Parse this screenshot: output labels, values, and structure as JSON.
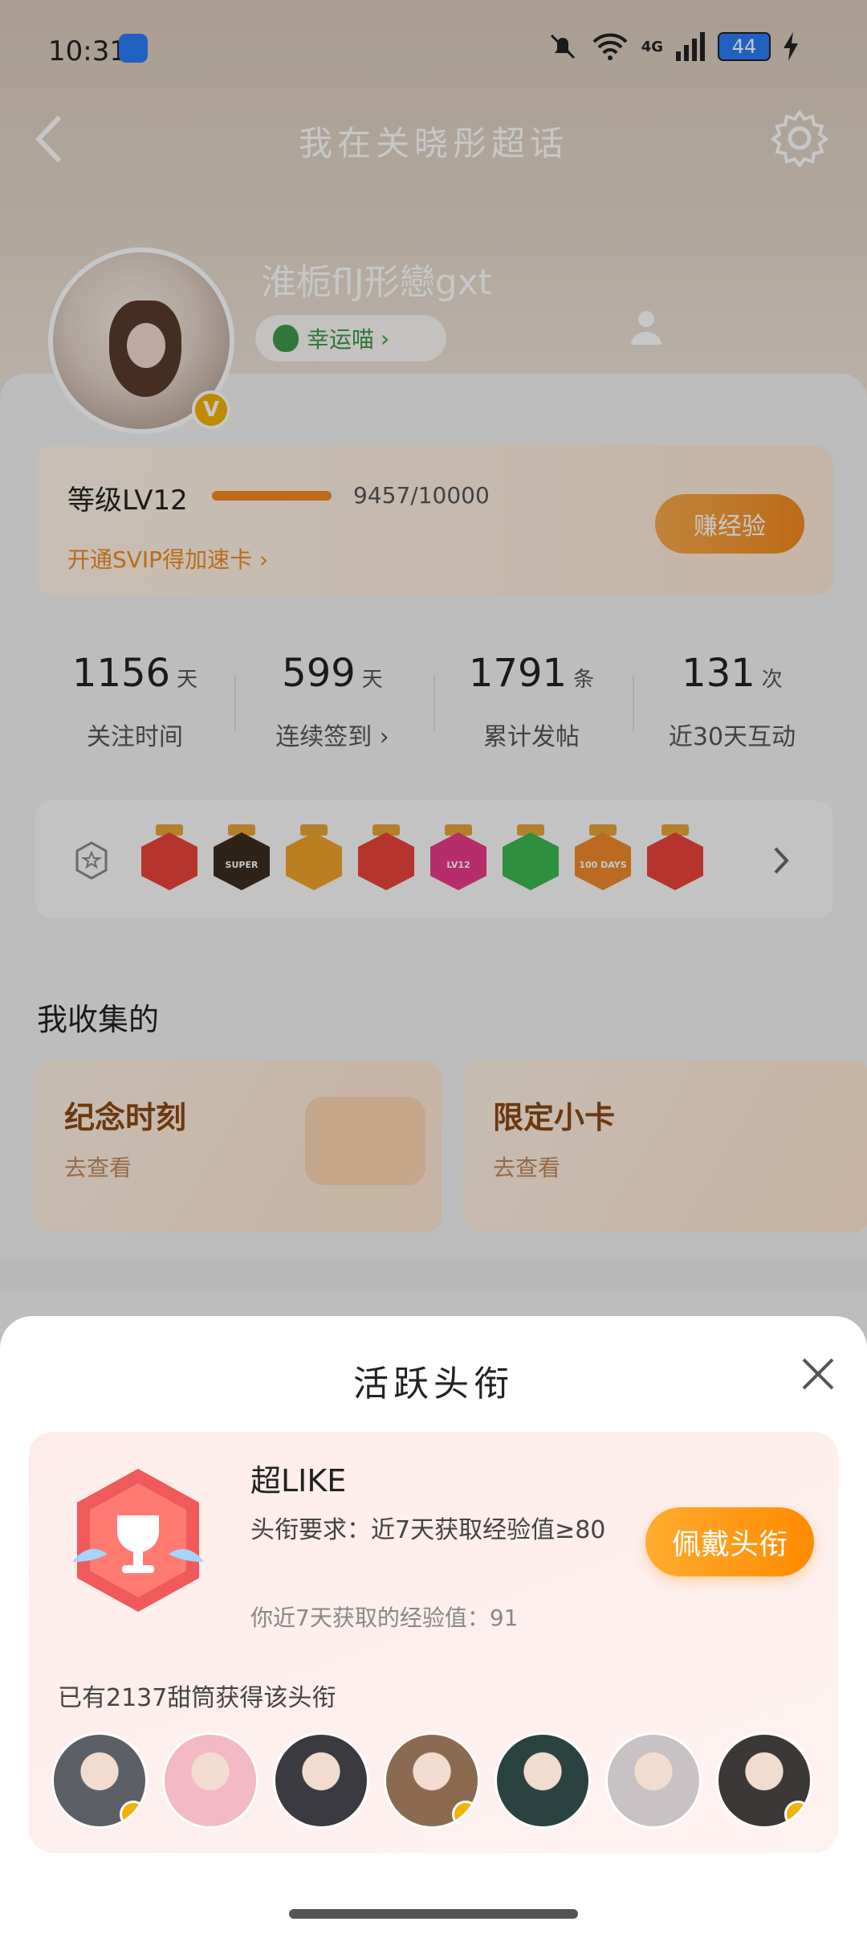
{
  "status_bar": {
    "time": "10:31",
    "network": "4G",
    "battery": "44"
  },
  "header": {
    "title": "我在关晓彤超话",
    "username": "淮栀flJ形戀gxt",
    "lucky_label": "幸运喵"
  },
  "level": {
    "label": "等级LV12",
    "progress": "9457/10000",
    "progress_fraction": 0.9457,
    "svip_link": "开通SVIP得加速卡",
    "earn_button": "赚经验"
  },
  "stats": [
    {
      "value": "1156",
      "unit": "天",
      "label": "关注时间"
    },
    {
      "value": "599",
      "unit": "天",
      "label": "连续签到"
    },
    {
      "value": "1791",
      "unit": "条",
      "label": "累计发帖"
    },
    {
      "value": "131",
      "unit": "次",
      "label": "近30天互动"
    }
  ],
  "badges": [
    {
      "icon": "cat-badge",
      "color": "#e8453c",
      "text": ""
    },
    {
      "icon": "crown-super-badge",
      "color": "#3c2c20",
      "text": "SUPER"
    },
    {
      "icon": "crown-badge",
      "color": "#f0a22b",
      "text": ""
    },
    {
      "icon": "cat-face-badge",
      "color": "#e8453c",
      "text": ""
    },
    {
      "icon": "lv12-badge",
      "color": "#e83c8a",
      "text": "LV12"
    },
    {
      "icon": "hand-badge",
      "color": "#3cb850",
      "text": ""
    },
    {
      "icon": "100-days-badge",
      "color": "#f08a2b",
      "text": "100 DAYS"
    },
    {
      "icon": "trophy-badge",
      "color": "#e8453c",
      "text": ""
    }
  ],
  "collection": {
    "title": "我收集的",
    "cards": [
      {
        "title": "纪念时刻",
        "subtitle": "去查看"
      },
      {
        "title": "限定小卡",
        "subtitle": "去查看"
      }
    ]
  },
  "modal": {
    "title": "活跃头衔",
    "title_name": "超LIKE",
    "requirement": "头衔要求：近7天获取经验值≥80",
    "my_exp": "你近7天获取的经验值：91",
    "wear_button": "佩戴头衔",
    "owners_text": "已有2137甜筒获得该头衔"
  },
  "owner_avatars": [
    {
      "color": "#5c5f66",
      "verified": true
    },
    {
      "color": "#f3b9c4",
      "verified": false
    },
    {
      "color": "#3a3a40",
      "verified": false
    },
    {
      "color": "#8c6a52",
      "verified": true
    },
    {
      "color": "#2a4240",
      "verified": false
    },
    {
      "color": "#c9c2c4",
      "verified": false
    },
    {
      "color": "#3c3838",
      "verified": true
    }
  ],
  "colors": {
    "accent": "#f28a1f",
    "verified": "#f2b300"
  }
}
